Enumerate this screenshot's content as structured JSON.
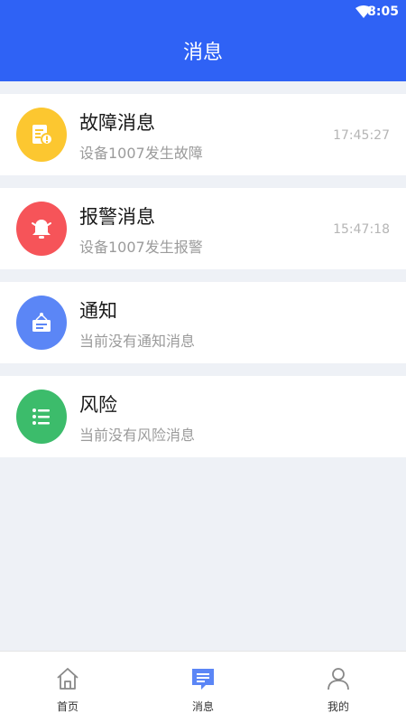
{
  "status_bar": {
    "time": "8:05"
  },
  "header": {
    "title": "消息"
  },
  "messages": [
    {
      "title": "故障消息",
      "desc": "设备1007发生故障",
      "time": "17:45:27",
      "color": "#fcc730",
      "icon": "fault-doc-icon"
    },
    {
      "title": "报警消息",
      "desc": "设备1007发生报警",
      "time": "15:47:18",
      "color": "#f65459",
      "icon": "bell-icon"
    },
    {
      "title": "通知",
      "desc": "当前没有通知消息",
      "time": "",
      "color": "#5b86f6",
      "icon": "notice-board-icon"
    },
    {
      "title": "风险",
      "desc": "当前没有风险消息",
      "time": "",
      "color": "#3cbc6b",
      "icon": "list-icon"
    }
  ],
  "tabbar": {
    "tabs": [
      {
        "label": "首页",
        "icon": "home-icon"
      },
      {
        "label": "消息",
        "icon": "message-icon",
        "active": true
      },
      {
        "label": "我的",
        "icon": "user-icon"
      }
    ]
  },
  "colors": {
    "primary": "#2f62f5",
    "background": "#eef1f6"
  }
}
